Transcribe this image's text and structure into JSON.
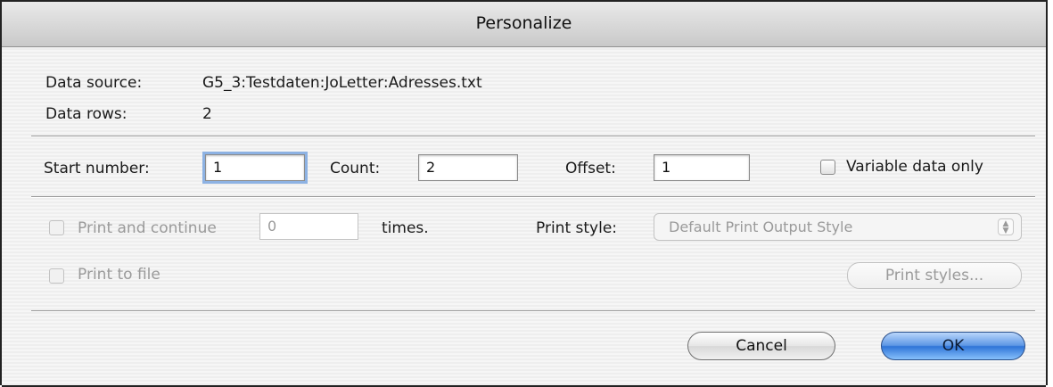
{
  "dialog": {
    "title": "Personalize",
    "data_source_label": "Data source:",
    "data_source_value": "G5_3:Testdaten:JoLetter:Adresses.txt",
    "data_rows_label": "Data rows:",
    "data_rows_value": "2"
  },
  "range": {
    "start_label": "Start number:",
    "start_value": "1",
    "count_label": "Count:",
    "count_value": "2",
    "offset_label": "Offset:",
    "offset_value": "1",
    "variable_only_label": "Variable data only",
    "variable_only_checked": false
  },
  "printing": {
    "print_continue_label": "Print and continue",
    "print_continue_value": "0",
    "times_label": "times.",
    "print_style_label": "Print style:",
    "print_style_value": "Default Print Output Style",
    "print_to_file_label": "Print to file",
    "print_styles_button": "Print styles..."
  },
  "buttons": {
    "cancel": "Cancel",
    "ok": "OK"
  },
  "colors": {
    "default_button": "#3a7fdc",
    "focus_ring": "#8db2e3",
    "disabled_text": "#9a9a9a"
  },
  "icons": {
    "stepper": "updown-stepper-icon"
  }
}
